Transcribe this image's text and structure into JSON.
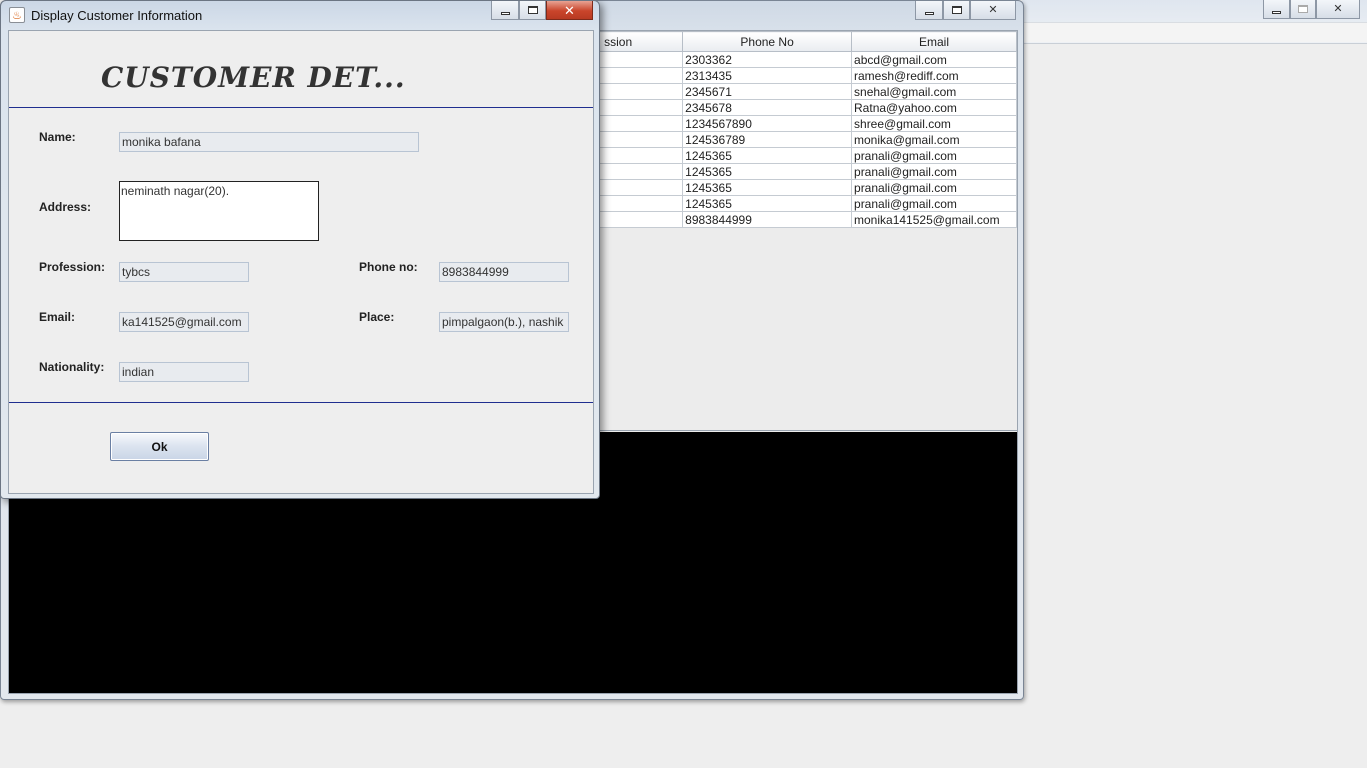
{
  "dialog": {
    "title": "Display Customer Information",
    "heading": "CUSTOMER DET...",
    "fields": {
      "name_label": "Name:",
      "name_value": "monika bafana",
      "address_label": "Address:",
      "address_value": "neminath nagar(20).",
      "profession_label": "Profession:",
      "profession_value": "tybcs",
      "phone_label": "Phone no:",
      "phone_value": "8983844999",
      "email_label": "Email:",
      "email_value": "ka141525@gmail.com",
      "place_label": "Place:",
      "place_value": "pimpalgaon(b.), nashik",
      "nationality_label": "Nationality:",
      "nationality_value": "indian"
    },
    "ok_label": "Ok",
    "close_glyph": "✕"
  },
  "main_window": {
    "close_glyph": "✕",
    "table": {
      "headers": [
        "ssion",
        "Phone No",
        "Email"
      ],
      "rows": [
        [
          "",
          "2303362",
          "abcd@gmail.com"
        ],
        [
          "",
          "2313435",
          "ramesh@rediff.com"
        ],
        [
          "",
          "2345671",
          "snehal@gmail.com"
        ],
        [
          "",
          "2345678",
          "Ratna@yahoo.com"
        ],
        [
          "",
          "1234567890",
          "shree@gmail.com"
        ],
        [
          "",
          "124536789",
          "monika@gmail.com"
        ],
        [
          "",
          "1245365",
          "pranali@gmail.com"
        ],
        [
          "",
          "1245365",
          "pranali@gmail.com"
        ],
        [
          "",
          "1245365",
          "pranali@gmail.com"
        ],
        [
          "",
          "1245365",
          "pranali@gmail.com"
        ],
        [
          "",
          "8983844999",
          "monika141525@gmail.com"
        ]
      ]
    }
  },
  "bg_window": {
    "close_glyph": "✕"
  }
}
